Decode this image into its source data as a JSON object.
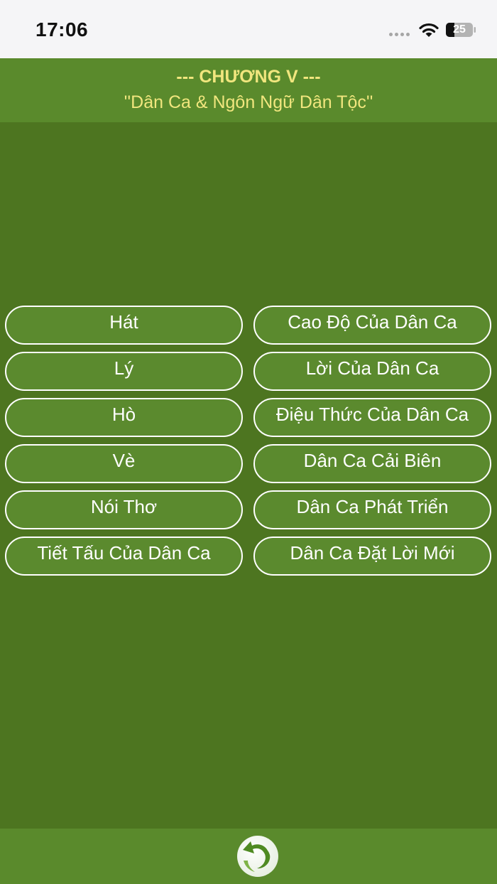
{
  "status_bar": {
    "time": "17:06",
    "battery": "25"
  },
  "header": {
    "chapter": "--- CHƯƠNG V ---",
    "subtitle": "''Dân Ca & Ngôn Ngữ Dân Tộc''"
  },
  "topics": {
    "left": [
      "Hát",
      "Lý",
      "Hò",
      "Vè",
      "Nói Thơ",
      "Tiết Tấu Của Dân Ca"
    ],
    "right": [
      "Cao Độ Của Dân Ca",
      "Lời Của Dân Ca",
      "Điệu Thức Của Dân Ca",
      "Dân Ca Cải Biên",
      "Dân Ca Phát Triển",
      "Dân Ca Đặt Lời Mới"
    ]
  },
  "footer": {
    "back_icon": "back-arrow-icon"
  },
  "colors": {
    "header_bg": "#5a8a2c",
    "main_bg": "#4d7520",
    "title_text": "#f1e67e",
    "button_bg": "#5b8a2e",
    "button_border": "#ffffff"
  }
}
